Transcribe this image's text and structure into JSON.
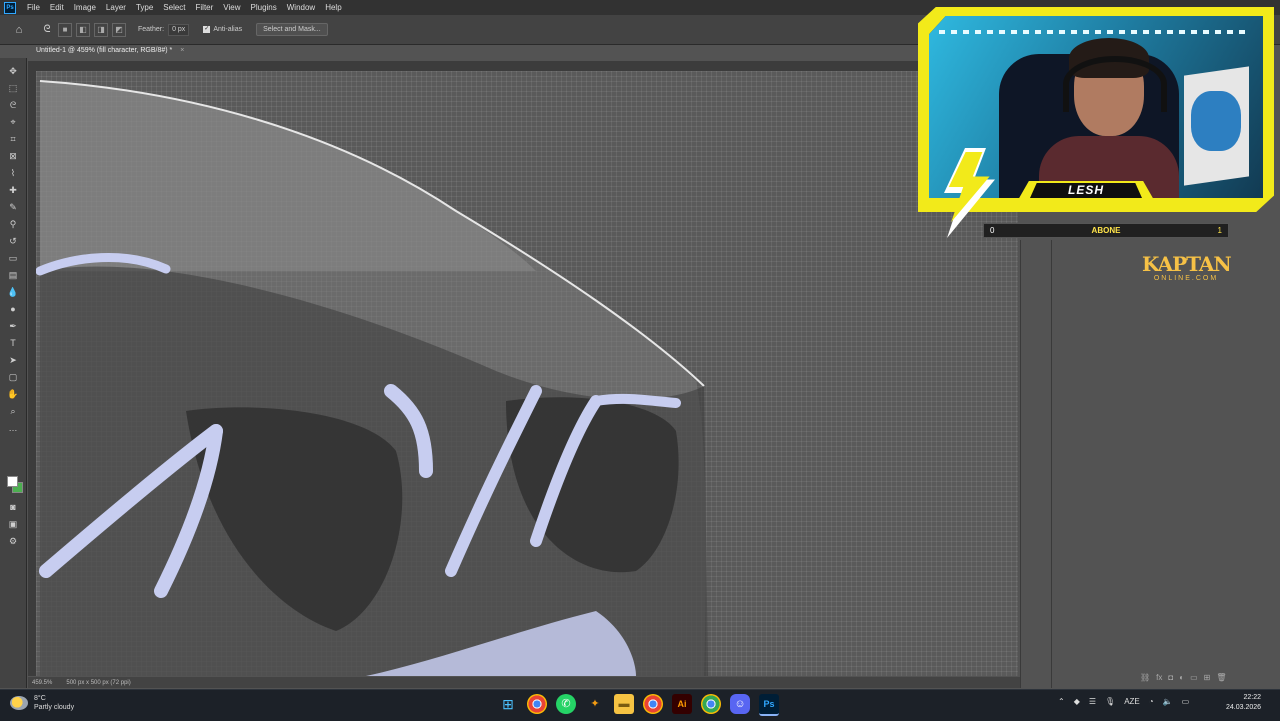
{
  "app": {
    "menu": [
      "File",
      "Edit",
      "Image",
      "Layer",
      "Type",
      "Select",
      "Filter",
      "View",
      "Plugins",
      "Window",
      "Help"
    ]
  },
  "options_bar": {
    "feather_label": "Feather:",
    "feather_value": "0 px",
    "anti_alias_label": "Anti-alias",
    "select_mask_label": "Select and Mask..."
  },
  "document": {
    "tab_title": "Untitled-1 @ 459% (fill character, RGB/8#) *"
  },
  "status": {
    "zoom": "459.5%",
    "doc_info": "500 px x 500 px (72 ppi)"
  },
  "overlay": {
    "streamer_name": "LESH",
    "sub_left": "0",
    "sub_label": "ABONE",
    "sub_right": "1",
    "brand_line1": "KAPTAN",
    "brand_line2": "ONLINE.COM"
  },
  "taskbar": {
    "temperature": "8°C",
    "weather": "Partly cloudy",
    "lang": "AZE",
    "time": "22:22",
    "date": "24.03.2026",
    "apps": [
      "windows-start-icon",
      "chrome-icon",
      "whatsapp-icon",
      "app-orange-icon",
      "file-explorer-icon",
      "chrome-icon",
      "illustrator-icon",
      "chrome-icon",
      "discord-icon",
      "photoshop-icon"
    ]
  },
  "colors": {
    "workspace": "#535353",
    "panel": "#434343",
    "menubar": "#323232",
    "overlay_yellow": "#f2ea1a",
    "brand_gold": "#f6c146",
    "taskbar": "#1c2128"
  }
}
